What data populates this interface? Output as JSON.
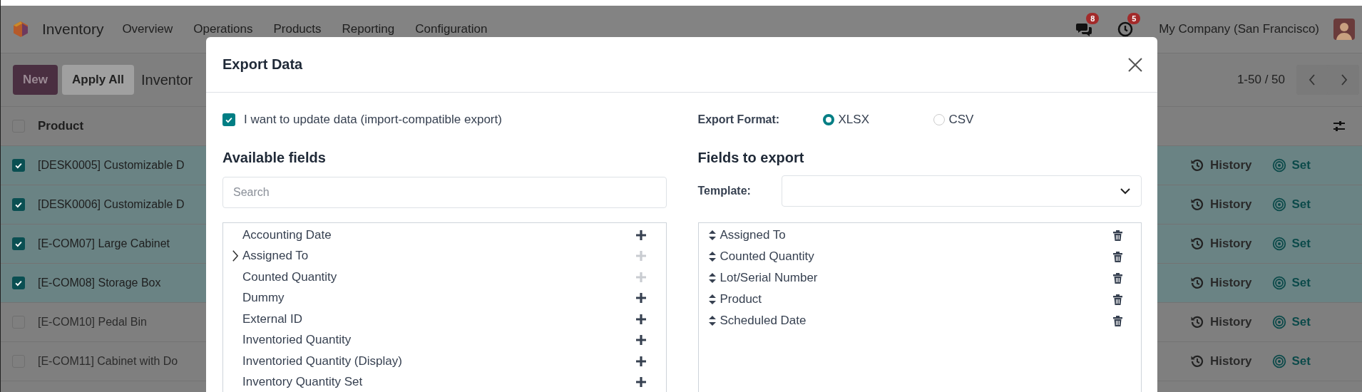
{
  "navbar": {
    "app_name": "Inventory",
    "menu": [
      "Overview",
      "Operations",
      "Products",
      "Reporting",
      "Configuration"
    ],
    "messages_badge": "8",
    "activities_badge": "5",
    "company": "My Company (San Francisco)"
  },
  "control_panel": {
    "buttons": [
      {
        "label": "New",
        "kind": "primary"
      },
      {
        "label": "Apply All",
        "kind": "secondary"
      }
    ],
    "breadcrumb": "Inventor",
    "pager": "1-50 / 50"
  },
  "table": {
    "header_checked": false,
    "columns": [
      "Product"
    ],
    "rows": [
      {
        "product": "[DESK0005] Customizable D",
        "selected": true,
        "history": "History",
        "set": "Set"
      },
      {
        "product": "[DESK0006] Customizable D",
        "selected": true,
        "history": "History",
        "set": "Set"
      },
      {
        "product": "[E-COM07] Large Cabinet",
        "selected": true,
        "history": "History",
        "set": "Set"
      },
      {
        "product": "[E-COM08] Storage Box",
        "selected": true,
        "history": "History",
        "set": "Set"
      },
      {
        "product": "[E-COM10] Pedal Bin",
        "selected": false,
        "history": "History",
        "set": "Set"
      },
      {
        "product": "[E-COM11] Cabinet with Do",
        "selected": false,
        "history": "History",
        "set": "Set"
      }
    ]
  },
  "dialog": {
    "title": "Export Data",
    "import_compatible": {
      "label": "I want to update data (import-compatible export)",
      "checked": true
    },
    "export_format": {
      "label": "Export Format:",
      "options": [
        {
          "label": "XLSX",
          "selected": true
        },
        {
          "label": "CSV",
          "selected": false
        }
      ]
    },
    "available_fields": {
      "heading": "Available fields",
      "search": {
        "placeholder": "Search"
      },
      "items": [
        {
          "label": "Accounting Date",
          "expandable": false,
          "disabled": false
        },
        {
          "label": "Assigned To",
          "expandable": true,
          "disabled": true
        },
        {
          "label": "Counted Quantity",
          "expandable": false,
          "disabled": true
        },
        {
          "label": "Dummy",
          "expandable": false,
          "disabled": false
        },
        {
          "label": "External ID",
          "expandable": false,
          "disabled": false
        },
        {
          "label": "Inventoried Quantity",
          "expandable": false,
          "disabled": false
        },
        {
          "label": "Inventoried Quantity (Display)",
          "expandable": false,
          "disabled": false
        },
        {
          "label": "Inventory Quantity Set",
          "expandable": false,
          "disabled": false
        }
      ]
    },
    "fields_to_export": {
      "heading": "Fields to export",
      "template_label": "Template:",
      "items": [
        "Assigned To",
        "Counted Quantity",
        "Lot/Serial Number",
        "Product",
        "Scheduled Date"
      ]
    }
  }
}
